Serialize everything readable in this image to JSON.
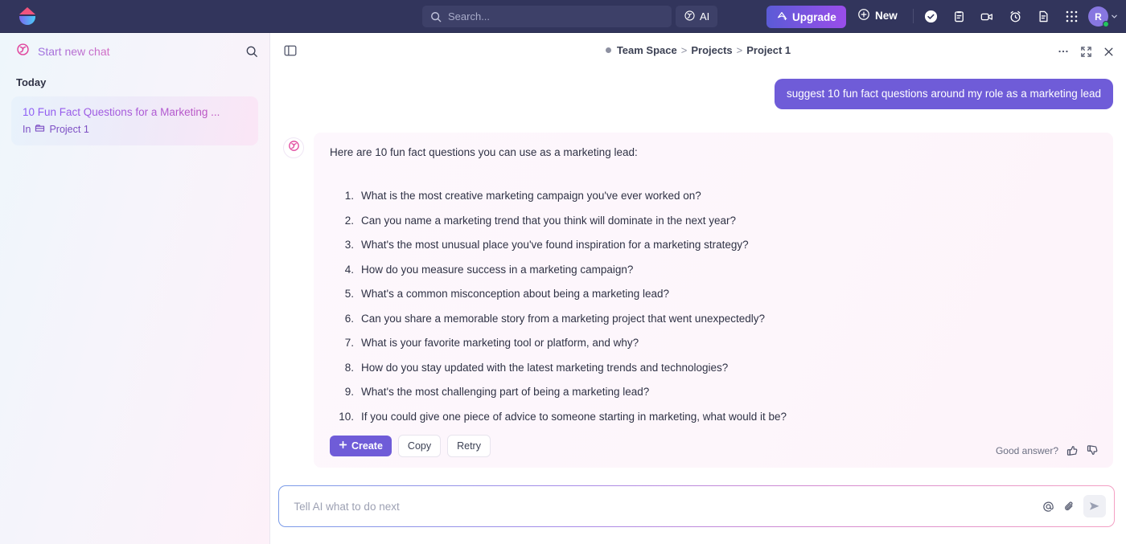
{
  "topbar": {
    "logo_name": "clickup-logo",
    "search": {
      "placeholder": "Search...",
      "value": "",
      "icon": "search-icon"
    },
    "ai_button": {
      "label": "AI",
      "icon": "ai-sparkle-icon"
    },
    "upgrade_button": {
      "label": "Upgrade",
      "icon": "rocket-icon"
    },
    "new_button": {
      "label": "New",
      "icon": "plus-circle-icon"
    },
    "icons": [
      {
        "name": "check-circle-icon"
      },
      {
        "name": "clipboard-icon"
      },
      {
        "name": "video-camera-icon"
      },
      {
        "name": "alarm-clock-icon"
      },
      {
        "name": "document-icon"
      },
      {
        "name": "apps-grid-icon"
      }
    ],
    "avatar": {
      "initial": "R",
      "status": "online",
      "chevron": "chevron-down-icon"
    },
    "colors": {
      "bar_bg": "#32355c",
      "upgrade_gradient_start": "#5b5bd6",
      "upgrade_gradient_end": "#9a4dea"
    }
  },
  "sidebar": {
    "new_chat": {
      "label": "Start new chat",
      "icon": "ai-swirl-icon"
    },
    "search_icon": "search-icon",
    "section_label": "Today",
    "chats": [
      {
        "title": "10 Fun Fact Questions for a Marketing ...",
        "location_prefix": "In",
        "location_icon": "folder-icon",
        "location": "Project 1"
      }
    ]
  },
  "main": {
    "panel_toggle_icon": "sidebar-toggle-icon",
    "breadcrumb": {
      "dot": "space-dot",
      "items": [
        "Team Space",
        "Projects",
        "Project 1"
      ],
      "separator": ">"
    },
    "header_actions": [
      {
        "name": "more-options-icon",
        "glyph": "···"
      },
      {
        "name": "expand-icon"
      },
      {
        "name": "close-icon"
      }
    ],
    "user_message": "suggest 10 fun fact questions around my role as a marketing lead",
    "ai_avatar_icon": "ai-swirl-icon",
    "ai_intro": "Here are 10 fun fact questions you can use as a marketing lead:",
    "ai_items": [
      {
        "num": "1.",
        "text": "What is the most creative marketing campaign you've ever worked on?"
      },
      {
        "num": "2.",
        "text": "Can you name a marketing trend that you think will dominate in the next year?"
      },
      {
        "num": "3.",
        "text": "What's the most unusual place you've found inspiration for a marketing strategy?"
      },
      {
        "num": "4.",
        "text": "How do you measure success in a marketing campaign?"
      },
      {
        "num": "5.",
        "text": "What's a common misconception about being a marketing lead?"
      },
      {
        "num": "6.",
        "text": "Can you share a memorable story from a marketing project that went unexpectedly?"
      },
      {
        "num": "7.",
        "text": "What is your favorite marketing tool or platform, and why?"
      },
      {
        "num": "8.",
        "text": "How do you stay updated with the latest marketing trends and technologies?"
      },
      {
        "num": "9.",
        "text": "What's the most challenging part of being a marketing lead?"
      },
      {
        "num": "10.",
        "text": "If you could give one piece of advice to someone starting in marketing, what would it be?"
      }
    ],
    "actions": {
      "create_label": "Create",
      "create_icon": "plus-icon",
      "copy_label": "Copy",
      "retry_label": "Retry"
    },
    "feedback": {
      "prompt": "Good answer?",
      "up_icon": "thumbs-up-icon",
      "down_icon": "thumbs-down-icon"
    },
    "composer": {
      "placeholder": "Tell AI what to do next",
      "value": "",
      "mention_icon": "at-mention-icon",
      "attach_icon": "paperclip-icon",
      "send_icon": "send-icon"
    },
    "colors": {
      "user_bubble": "#6f5cd8",
      "ai_card_bg": "#fdf7fd",
      "accent": "#6f5cd8"
    }
  }
}
